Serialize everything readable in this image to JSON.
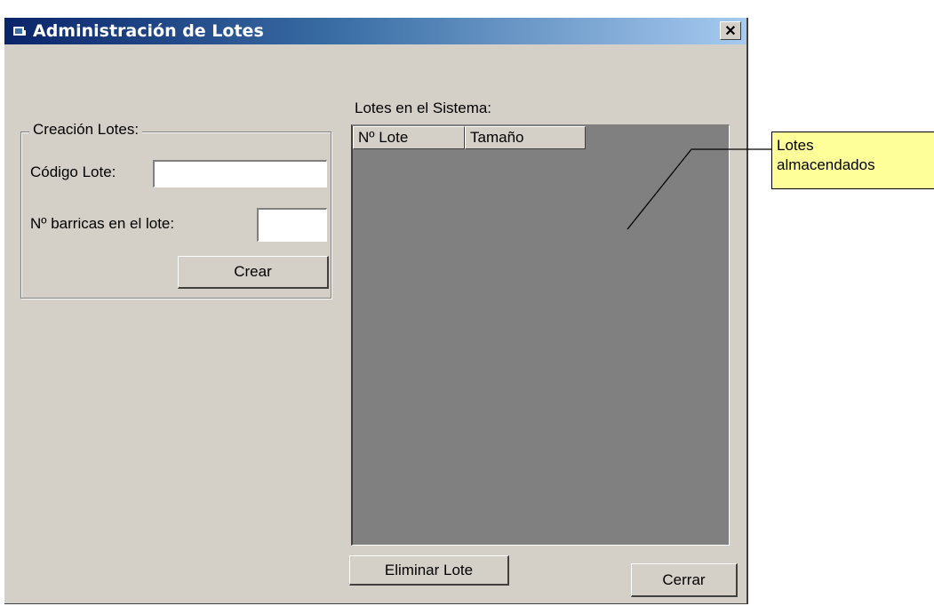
{
  "window": {
    "title": "Administración de Lotes",
    "close_symbol": "✕"
  },
  "creation": {
    "group_title": "Creación Lotes:",
    "code_label": "Código Lote:",
    "code_value": "",
    "barrels_label": "Nº barricas en el lote:",
    "barrels_value": "",
    "create_button": "Crear"
  },
  "system": {
    "list_label": "Lotes en el Sistema:",
    "columns": [
      "Nº Lote",
      "Tamaño"
    ],
    "rows": []
  },
  "buttons": {
    "delete": "Eliminar Lote",
    "close": "Cerrar"
  },
  "callout": {
    "line1": "Lotes",
    "line2": "almacendados"
  },
  "colors": {
    "window_bg": "#d4d0c8",
    "title_start": "#0a246a",
    "title_end": "#a6caf0",
    "list_bg": "#808080",
    "callout_bg": "#ffff99"
  }
}
